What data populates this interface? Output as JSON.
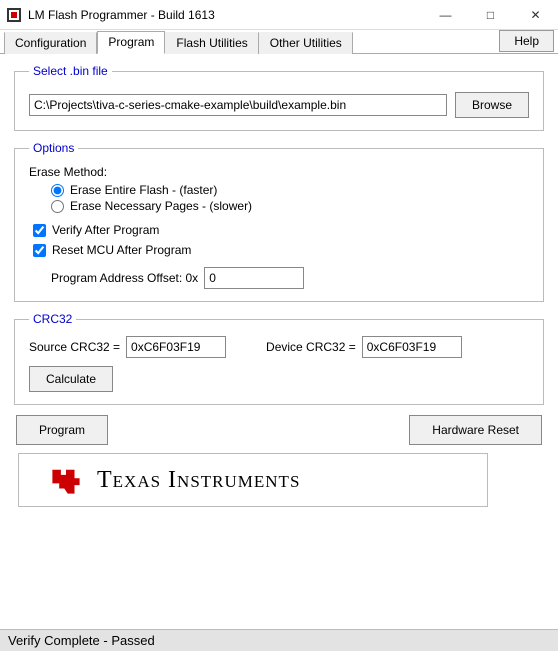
{
  "window": {
    "title": "LM Flash Programmer - Build 1613",
    "min": "—",
    "max": "□",
    "close": "✕"
  },
  "tabs": {
    "items": [
      "Configuration",
      "Program",
      "Flash Utilities",
      "Other Utilities"
    ],
    "active_index": 1,
    "help": "Help"
  },
  "select_bin": {
    "legend": "Select .bin file",
    "path": "C:\\Projects\\tiva-c-series-cmake-example\\build\\example.bin",
    "browse": "Browse"
  },
  "options": {
    "legend": "Options",
    "erase_label": "Erase Method:",
    "erase_entire": "Erase Entire Flash - (faster)",
    "erase_pages": "Erase Necessary Pages - (slower)",
    "erase_selected": "entire",
    "verify": {
      "label": "Verify After Program",
      "checked": true
    },
    "reset": {
      "label": "Reset MCU After Program",
      "checked": true
    },
    "offset_label": "Program Address Offset:   0x",
    "offset_value": "0"
  },
  "crc": {
    "legend": "CRC32",
    "source_label": "Source CRC32 =",
    "source_value": "0xC6F03F19",
    "device_label": "Device CRC32 =",
    "device_value": "0xC6F03F19",
    "calculate": "Calculate"
  },
  "actions": {
    "program": "Program",
    "hw_reset": "Hardware Reset"
  },
  "footer": {
    "brand": "Texas Instruments"
  },
  "status": {
    "text": "Verify Complete - Passed"
  }
}
